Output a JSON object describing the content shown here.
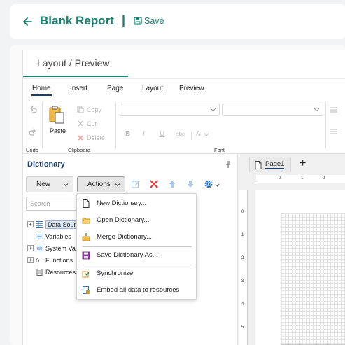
{
  "header": {
    "title": "Blank Report",
    "separator": "|",
    "save_label": "Save"
  },
  "view_tab": "Layout / Preview",
  "menu": [
    "Home",
    "Insert",
    "Page",
    "Layout",
    "Preview"
  ],
  "menu_active": "Home",
  "ribbon": {
    "undo_group": "Undo",
    "paste": "Paste",
    "copy": "Copy",
    "cut": "Cut",
    "delete": "Delete",
    "clipboard_group": "Clipboard",
    "font_group": "Font",
    "bold": "B",
    "italic": "I",
    "underline": "U",
    "strike": "abc",
    "font_size": "A"
  },
  "dictionary": {
    "title": "Dictionary",
    "new_label": "New",
    "actions_label": "Actions",
    "search_placeholder": "Search",
    "tree": [
      {
        "label": "Data Sources",
        "expander": "+",
        "selected": true
      },
      {
        "label": "Variables",
        "expander": ""
      },
      {
        "label": "System Variables",
        "expander": "+"
      },
      {
        "label": "Functions",
        "expander": "+"
      },
      {
        "label": "Resources",
        "expander": ""
      }
    ]
  },
  "actions_menu": [
    {
      "label": "New Dictionary...",
      "icon": "new-document-icon"
    },
    {
      "label": "Open Dictionary...",
      "icon": "open-folder-icon"
    },
    {
      "label": "Merge Dictionary...",
      "icon": "merge-icon"
    },
    {
      "label": "Save Dictionary As...",
      "icon": "save-icon"
    },
    {
      "label": "Synchronize",
      "icon": "synchronize-icon"
    },
    {
      "label": "Embed all data to resources",
      "icon": "embed-icon"
    }
  ],
  "design": {
    "page_tab": "Page1",
    "add": "+",
    "ruler_h": [
      "0",
      "1",
      "2"
    ],
    "ruler_v": [
      "0",
      "1",
      "2",
      "3",
      "4",
      "5"
    ]
  },
  "colors": {
    "accent": "#1a8070",
    "navy": "#1b3d6b",
    "delete_red": "#e53935",
    "settings_blue": "#1e6fd9"
  }
}
